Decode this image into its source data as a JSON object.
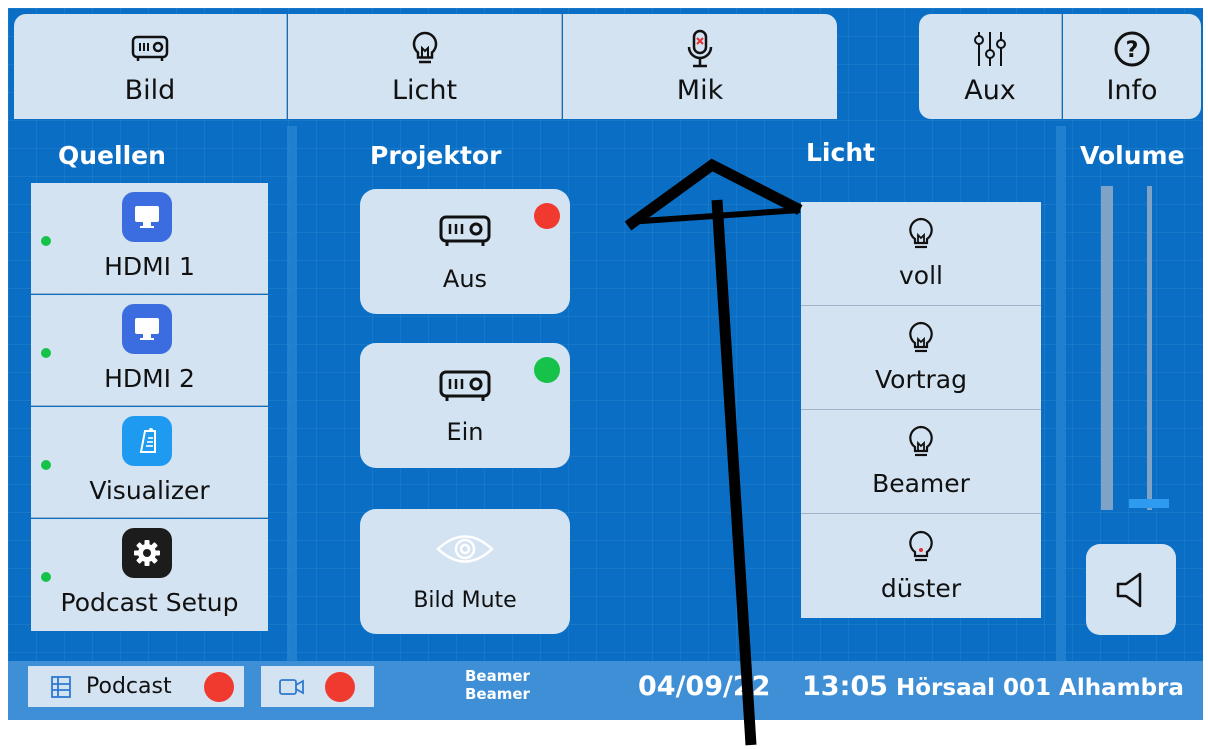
{
  "tabs": [
    {
      "label": "Bild",
      "icon": "projector-icon"
    },
    {
      "label": "Licht",
      "icon": "lightbulb-icon"
    },
    {
      "label": "Mik",
      "icon": "microphone-muted-icon"
    },
    {
      "label": "Aux",
      "icon": "mixer-sliders-icon"
    },
    {
      "label": "Info",
      "icon": "help-circle-icon"
    }
  ],
  "sections": {
    "sources_title": "Quellen",
    "projector_title": "Projektor",
    "light_title": "Licht",
    "volume_title": "Volume"
  },
  "sources": [
    {
      "label": "HDMI 1",
      "icon": "monitor-icon",
      "color": "#3c6de0",
      "status_color": "#16c24a"
    },
    {
      "label": "HDMI 2",
      "icon": "monitor-icon",
      "color": "#3c6de0",
      "status_color": "#16c24a"
    },
    {
      "label": "Visualizer",
      "icon": "document-camera-icon",
      "color": "#1e9bf0",
      "status_color": "#16c24a"
    },
    {
      "label": "Podcast Setup",
      "icon": "gear-icon",
      "color": "#1c1c1c",
      "status_color": "#16c24a"
    }
  ],
  "projector": {
    "off_label": "Aus",
    "off_indicator": "#f03a2f",
    "on_label": "Ein",
    "on_indicator": "#16c24a",
    "mute_label": "Bild Mute"
  },
  "light": [
    "voll",
    "Vortrag",
    "Beamer",
    "düster"
  ],
  "volume": {
    "level": 0.05
  },
  "bottom": {
    "podcast_label": "Podcast",
    "beamer_line1": "Beamer",
    "beamer_line2": "Beamer",
    "date": "04/09/22",
    "time": "13:05",
    "room": "Hörsaal 001 Alhambra"
  },
  "colors": {
    "background": "#0a6fc4",
    "panel": "#d4e3f2",
    "recording": "#f03a2f"
  }
}
